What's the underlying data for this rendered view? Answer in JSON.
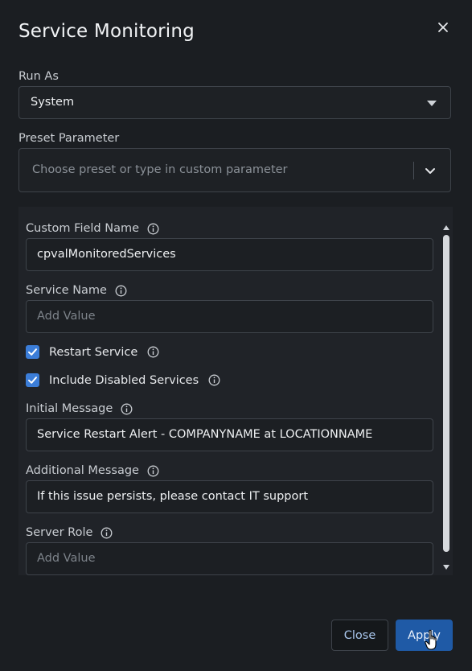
{
  "dialog": {
    "title": "Service Monitoring"
  },
  "run_as": {
    "label": "Run As",
    "value": "System"
  },
  "preset": {
    "label": "Preset Parameter",
    "placeholder": "Choose preset or type in custom parameter"
  },
  "fields": {
    "custom_field_name": {
      "label": "Custom Field Name",
      "value": "cpvalMonitoredServices"
    },
    "service_name": {
      "label": "Service Name",
      "placeholder": "Add Value"
    },
    "restart_service": {
      "label": "Restart Service",
      "checked": true
    },
    "include_disabled": {
      "label": "Include Disabled Services",
      "checked": true
    },
    "initial_message": {
      "label": "Initial Message",
      "value": "Service Restart Alert - COMPANYNAME at LOCATIONNAME"
    },
    "additional_message": {
      "label": "Additional Message",
      "value": "If this issue persists, please contact IT support"
    },
    "server_role": {
      "label": "Server Role",
      "placeholder": "Add Value"
    }
  },
  "buttons": {
    "close": "Close",
    "apply": "Apply"
  },
  "colors": {
    "background": "#1b1e22",
    "accent": "#3b7dd8",
    "apply_button": "#1f5aa6"
  },
  "icons": [
    "close-icon",
    "caret-down-icon",
    "chevron-down-icon",
    "info-icon",
    "checkmark-icon",
    "scroll-up-icon",
    "scroll-down-icon",
    "hand-pointer-icon"
  ]
}
